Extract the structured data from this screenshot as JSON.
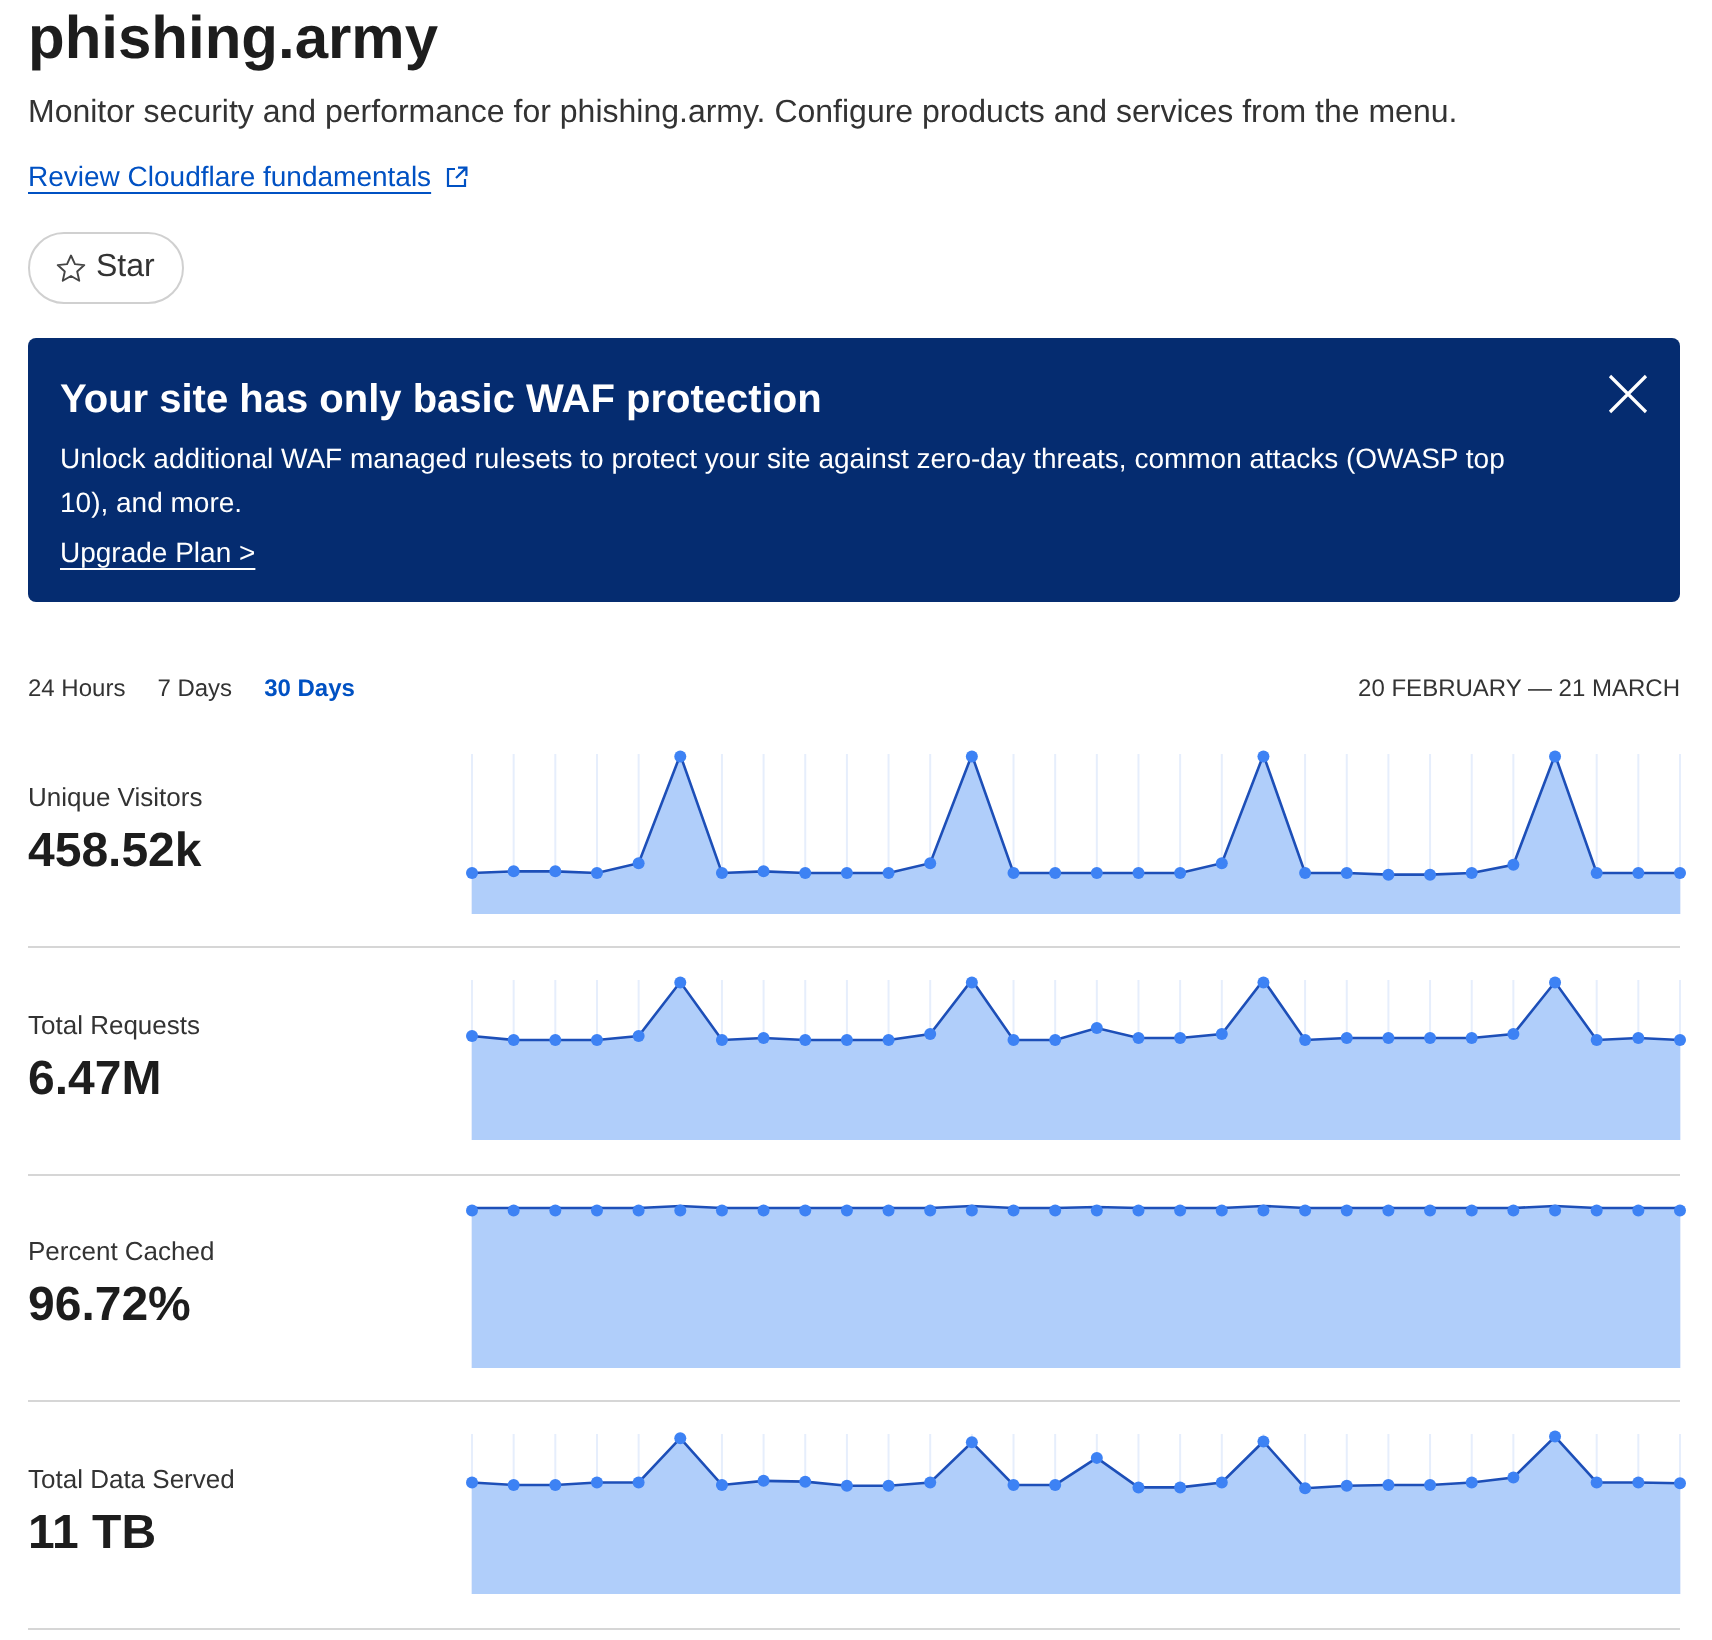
{
  "header": {
    "title": "phishing.army",
    "description": "Monitor security and performance for phishing.army. Configure products and services from the menu.",
    "link": "Review Cloudflare fundamentals",
    "star_button": "Star"
  },
  "banner": {
    "title": "Your site has only basic WAF protection",
    "message": "Unlock additional WAF managed rulesets to protect your site against zero-day threats, common attacks (OWASP top 10), and more.",
    "link": "Upgrade Plan >"
  },
  "time_ranges": [
    {
      "label": "24 Hours",
      "selected": false
    },
    {
      "label": "7 Days",
      "selected": false
    },
    {
      "label": "30 Days",
      "selected": true
    }
  ],
  "date_range": "20 FEBRUARY — 21 MARCH",
  "metrics": [
    {
      "label": "Unique Visitors",
      "value": "458.52k"
    },
    {
      "label": "Total Requests",
      "value": "6.47M"
    },
    {
      "label": "Percent Cached",
      "value": "96.72%"
    },
    {
      "label": "Total Data Served",
      "value": "11 TB"
    }
  ]
}
